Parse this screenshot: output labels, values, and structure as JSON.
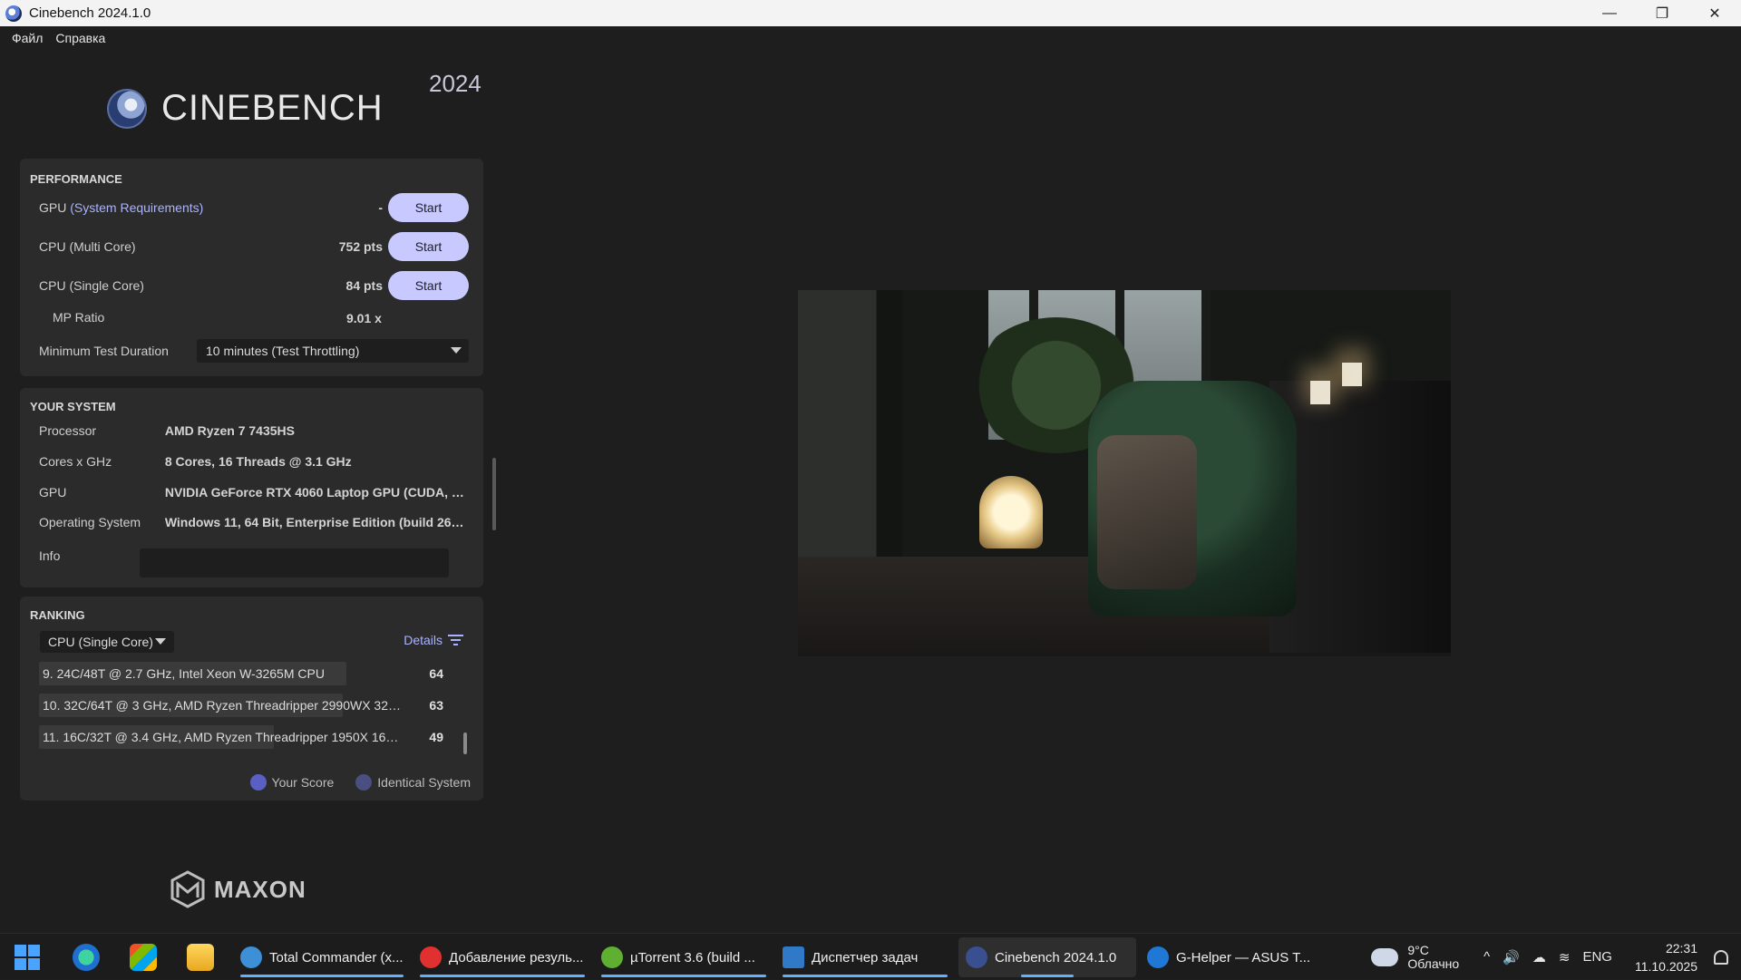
{
  "window": {
    "title": "Cinebench 2024.1.0",
    "minimize": "—",
    "restore": "❐",
    "close": "✕"
  },
  "menu": {
    "items": [
      "Файл",
      "Справка"
    ]
  },
  "brand": {
    "name": "CINEBENCH",
    "version": "2024",
    "footer": "MAXON"
  },
  "performance": {
    "title": "PERFORMANCE",
    "gpu": {
      "label": "GPU",
      "link": "(System Requirements)",
      "value": "-",
      "button": "Start"
    },
    "cpu_multi": {
      "label": "CPU (Multi Core)",
      "value": "752 pts",
      "button": "Start"
    },
    "cpu_single": {
      "label": "CPU (Single Core)",
      "value": "84 pts",
      "button": "Start"
    },
    "mp_ratio": {
      "label": "MP Ratio",
      "value": "9.01 x"
    },
    "min_duration": {
      "label": "Minimum Test Duration",
      "selected": "10 minutes (Test Throttling)"
    }
  },
  "system": {
    "title": "YOUR SYSTEM",
    "rows": [
      {
        "k": "Processor",
        "v": "AMD Ryzen 7 7435HS"
      },
      {
        "k": "Cores x GHz",
        "v": "8 Cores, 16 Threads @ 3.1 GHz"
      },
      {
        "k": "GPU",
        "v": "NVIDIA GeForce RTX 4060 Laptop GPU (CUDA, Dri..."
      },
      {
        "k": "Operating System",
        "v": "Windows 11, 64 Bit, Enterprise Edition (build 2620..."
      }
    ],
    "info_label": "Info"
  },
  "ranking": {
    "title": "RANKING",
    "selected": "CPU (Single Core)",
    "details": "Details",
    "rows": [
      {
        "text": "9. 24C/48T @ 2.7 GHz, Intel Xeon W-3265M CPU",
        "score": "64",
        "fill": 0.76
      },
      {
        "text": "10. 32C/64T @ 3 GHz, AMD Ryzen Threadripper 2990WX 32-Cor...",
        "score": "63",
        "fill": 0.75
      },
      {
        "text": "11. 16C/32T @ 3.4 GHz, AMD Ryzen Threadripper 1950X 16-Cor...",
        "score": "49",
        "fill": 0.58
      }
    ],
    "legend": [
      {
        "label": "Your Score",
        "color": "#5a5fc4"
      },
      {
        "label": "Identical System",
        "color": "#4a4e80"
      }
    ]
  },
  "taskbar": {
    "apps": [
      {
        "label": "Total Commander (x...",
        "color": "#3d8fd6"
      },
      {
        "label": "Добавление резуль...",
        "color": "#e0302f"
      },
      {
        "label": "µTorrent 3.6  (build ...",
        "color": "#5fb030"
      },
      {
        "label": "Диспетчер задач",
        "color": "#2f79c6"
      },
      {
        "label": "Cinebench 2024.1.0",
        "color": "#3a4f8f"
      },
      {
        "label": "G-Helper — ASUS T...",
        "color": "#1f77d6"
      }
    ],
    "weather": {
      "temp": "9°C",
      "desc": "Облачно"
    },
    "lang": "ENG",
    "time": "22:31",
    "date": "11.10.2025"
  },
  "colors": {
    "accent": "#c7c9ff",
    "link": "#a9b3ff",
    "panel": "#2b2b2b",
    "bg": "#1e1e1e"
  }
}
